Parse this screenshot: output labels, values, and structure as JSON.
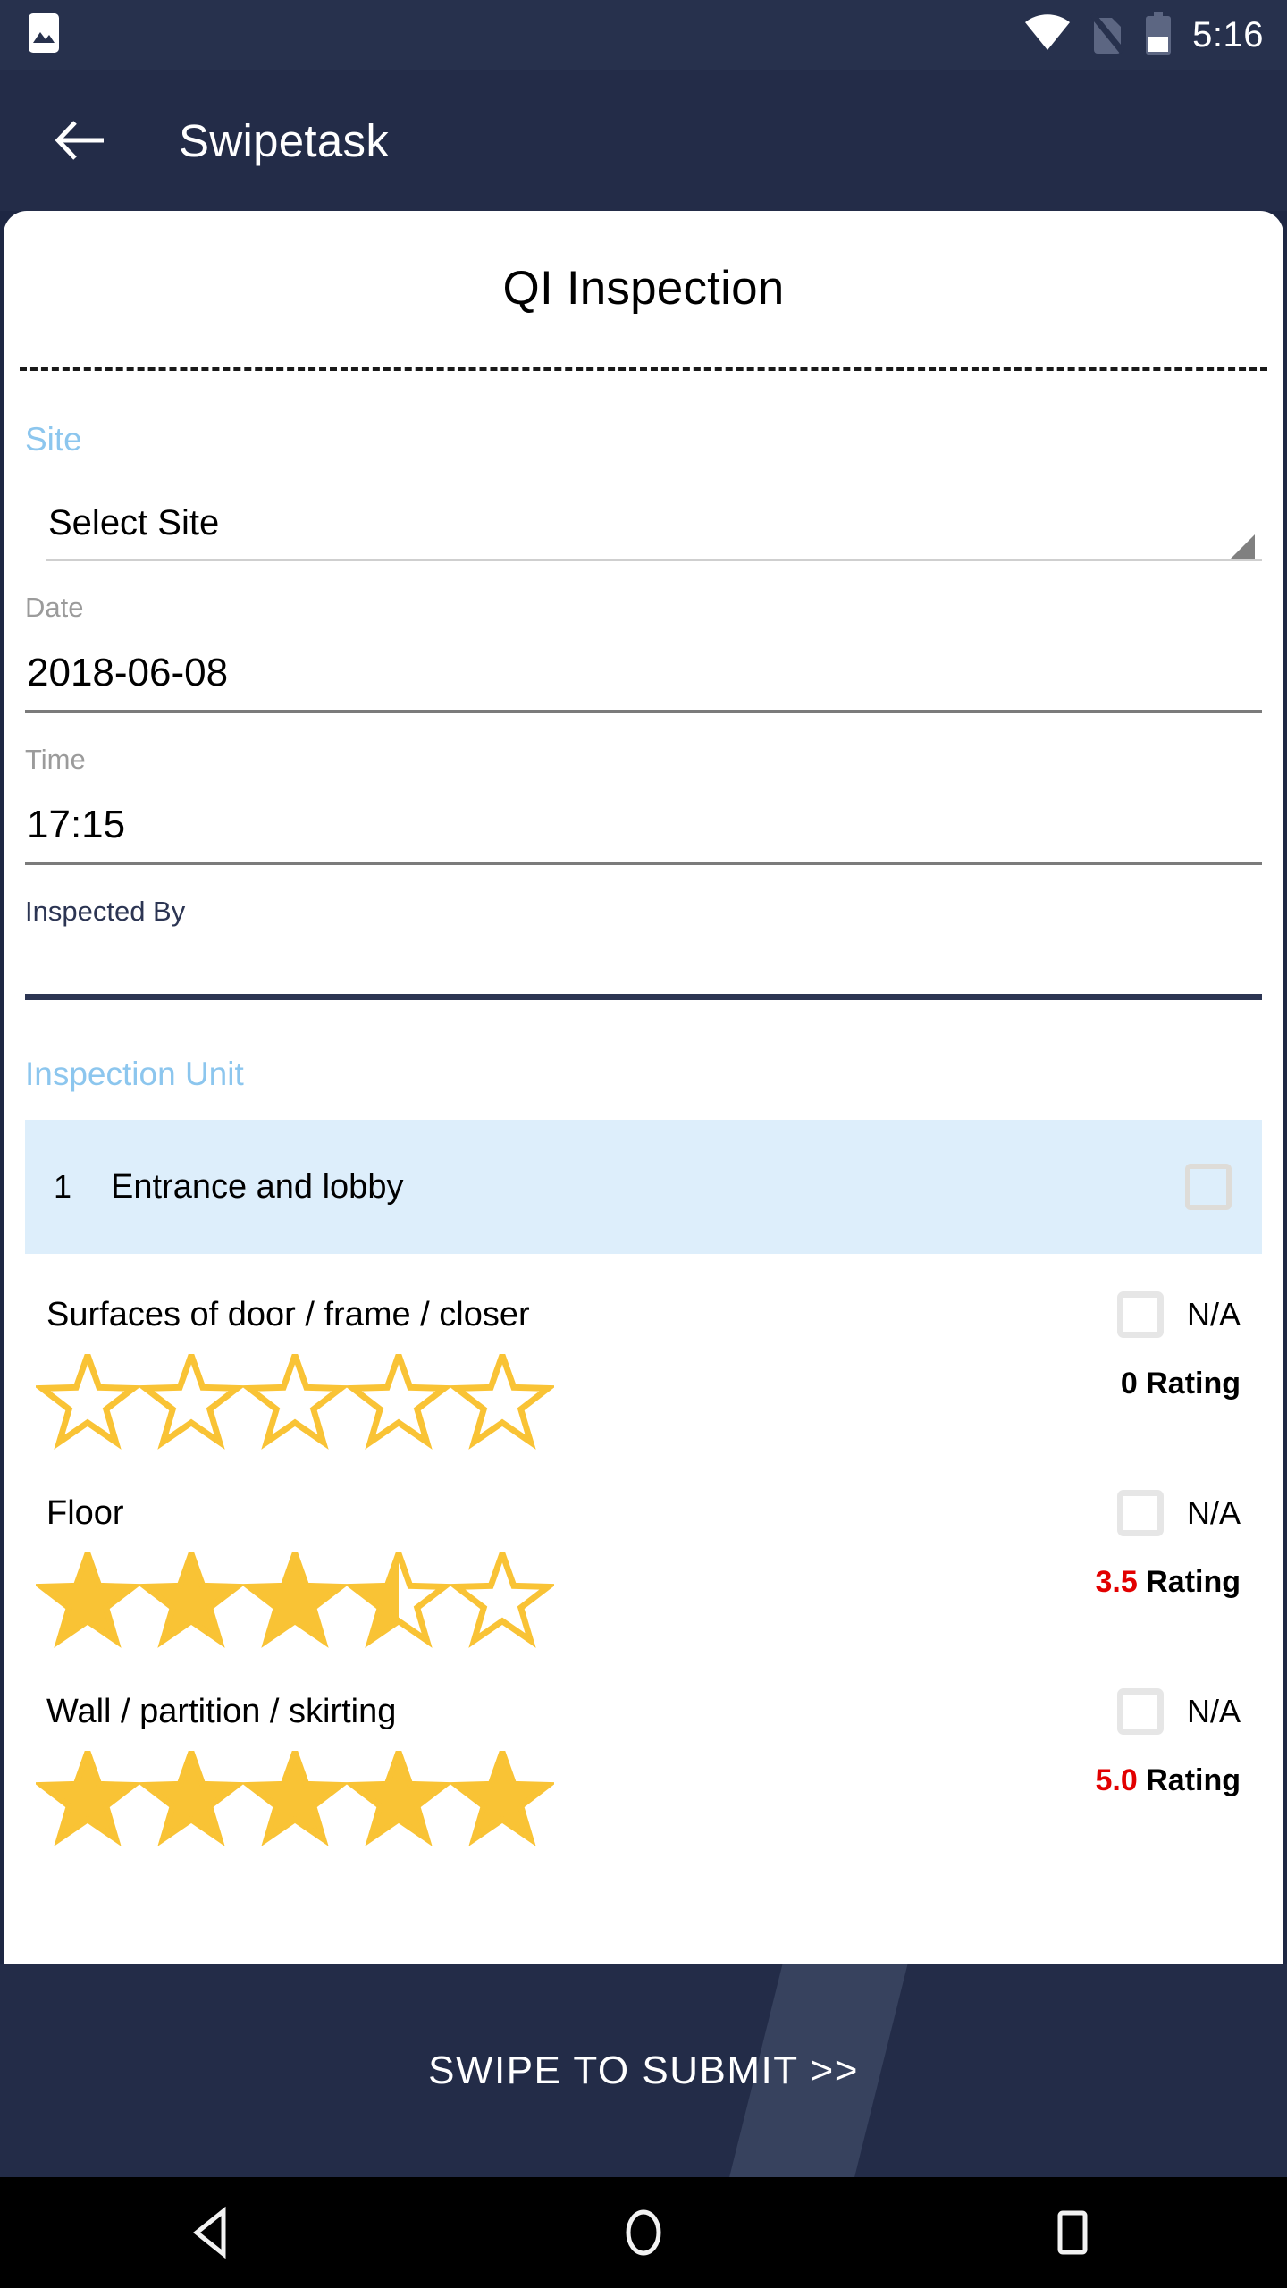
{
  "status_bar": {
    "notification_icon": "image-icon",
    "wifi_icon": "wifi-icon",
    "sim_icon": "sim-card-off-icon",
    "battery_icon": "battery-half-icon",
    "clock": "5:16"
  },
  "app_bar": {
    "back_icon": "arrow-left-icon",
    "title": "Swipetask"
  },
  "card": {
    "title": "QI Inspection"
  },
  "form": {
    "site": {
      "label": "Site",
      "value": "Select Site",
      "caret_icon": "dropdown-caret-icon"
    },
    "date": {
      "label": "Date",
      "value": "2018-06-08"
    },
    "time": {
      "label": "Time",
      "value": "17:15"
    },
    "inspected_by": {
      "label": "Inspected By",
      "value": "",
      "placeholder": ""
    }
  },
  "inspection_unit": {
    "label": "Inspection Unit",
    "units": [
      {
        "number": "1",
        "name": "Entrance and lobby",
        "checked": false
      }
    ]
  },
  "rating_items": [
    {
      "name": "Surfaces of  door / frame / closer",
      "na_label": "N/A",
      "na_checked": false,
      "rating_value": "0",
      "rating_suffix": " Rating",
      "stars": 0,
      "value_is_red": false
    },
    {
      "name": "Floor",
      "na_label": "N/A",
      "na_checked": false,
      "rating_value": "3.5",
      "rating_suffix": " Rating",
      "stars": 3.5,
      "value_is_red": true
    },
    {
      "name": "Wall / partition / skirting",
      "na_label": "N/A",
      "na_checked": false,
      "rating_value": "5.0",
      "rating_suffix": " Rating",
      "stars": 5,
      "value_is_red": true
    }
  ],
  "footer": {
    "swipe_label": "SWIPE TO SUBMIT >>"
  },
  "nav_bar": {
    "back_icon": "triangle-back-icon",
    "home_icon": "circle-home-icon",
    "recents_icon": "square-recents-icon"
  },
  "colors": {
    "app_bar": "#232c48",
    "status_bar": "#27314d",
    "accent_blue": "#8cc6ee",
    "unit_row": "#ddeefb",
    "star_gold": "#f9c335",
    "rating_red": "#e20000",
    "focus_underline": "#2c3553"
  }
}
